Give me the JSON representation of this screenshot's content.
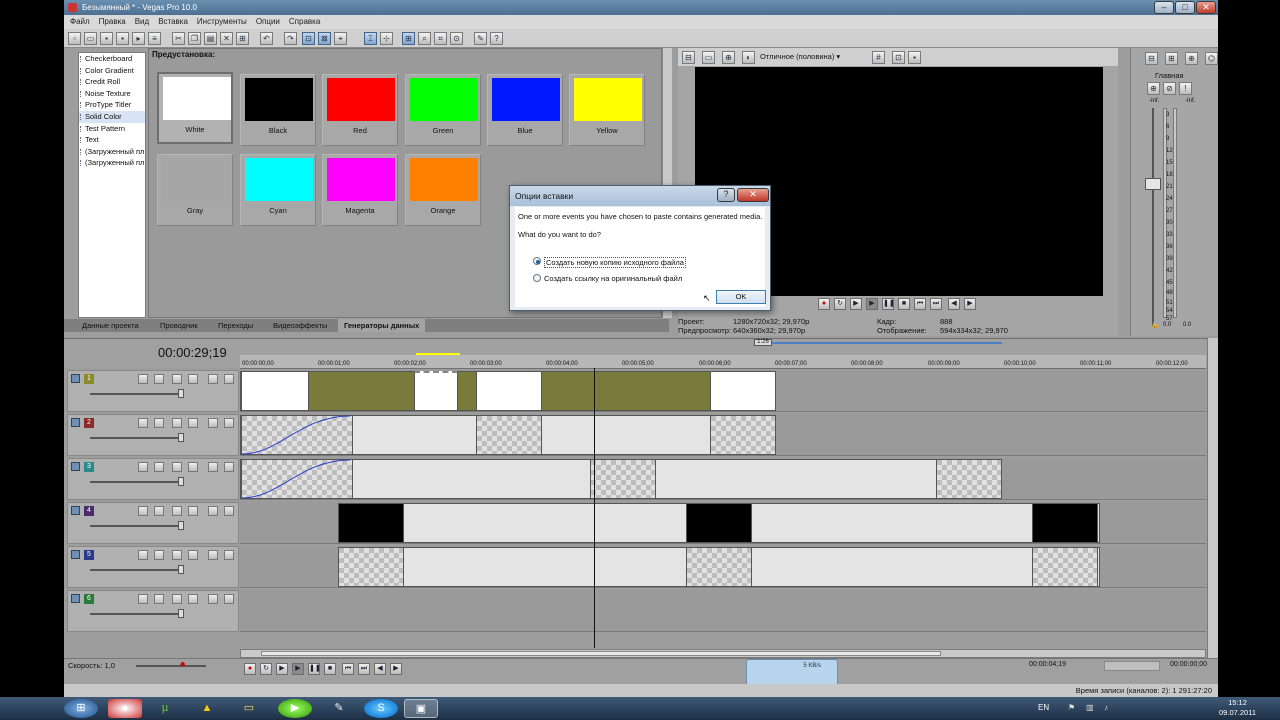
{
  "window": {
    "title": "Безымянный * - Vegas Pro 10.0",
    "minimize": "–",
    "maximize": "□",
    "close": "✕"
  },
  "menu": [
    "Файл",
    "Правка",
    "Вид",
    "Вставка",
    "Инструменты",
    "Опции",
    "Справка"
  ],
  "generators": {
    "items": [
      "Checkerboard",
      "Color Gradient",
      "Credit Roll",
      "Noise Texture",
      "ProType Titler",
      "Solid Color",
      "Test Pattern",
      "Text",
      "(Загруженный пл",
      "(Загруженный пл"
    ],
    "selected_index": 5,
    "preset_title": "Предустановка:",
    "presets": [
      {
        "label": "White",
        "color": "#ffffff"
      },
      {
        "label": "Black",
        "color": "#000000"
      },
      {
        "label": "Red",
        "color": "#ff0000"
      },
      {
        "label": "Green",
        "color": "#00ff00"
      },
      {
        "label": "Blue",
        "color": "#0018ff"
      },
      {
        "label": "Yellow",
        "color": "#ffff00"
      },
      {
        "label": "Gray",
        "color": "#a6a6a6"
      },
      {
        "label": "Cyan",
        "color": "#00ffff"
      },
      {
        "label": "Magenta",
        "color": "#ff00ff"
      },
      {
        "label": "Orange",
        "color": "#ff7f00"
      }
    ]
  },
  "tabs": [
    "Данные проекта",
    "Проводник",
    "Переходы",
    "Видеоэффекты",
    "Генераторы данных"
  ],
  "active_tab": 4,
  "preview": {
    "quality": "Отличное (половина)",
    "project_label": "Проект:",
    "project_value": "1280x720x32; 29,970p",
    "preview_label": "Предпросмотр:",
    "preview_value": "640x360x32; 29,970p",
    "frame_label": "Кадр:",
    "frame_value": "888",
    "display_label": "Отображение:",
    "display_value": "594x334x32; 29,970"
  },
  "mixer": {
    "title": "Главная",
    "left_db": "-Inf.",
    "right_db": "-Inf.",
    "scale": [
      "3",
      "6",
      "9",
      "12",
      "15",
      "18",
      "21",
      "24",
      "27",
      "30",
      "33",
      "36",
      "39",
      "42",
      "45",
      "48",
      "51",
      "54",
      "57"
    ],
    "out_left": "0.0",
    "out_right": "0.0"
  },
  "timeline": {
    "timecode": "00:00:29;19",
    "ruler": [
      "00:00:00;00",
      "00:00:01;00",
      "00:00:02;00",
      "00:00:03;00",
      "00:00:04;00",
      "00:00:05;00",
      "00:00:06;00",
      "00:00:07;00",
      "00:00:08;00",
      "00:00:09;00",
      "00:00:10;00",
      "00:00:11;00",
      "00:00:12;00"
    ],
    "tracks": [
      {
        "num": "1",
        "color": "#8a8a2a"
      },
      {
        "num": "2",
        "color": "#8a2a2a"
      },
      {
        "num": "3",
        "color": "#2a8a8a"
      },
      {
        "num": "4",
        "color": "#4a2a6a"
      },
      {
        "num": "5",
        "color": "#2a3a8a"
      },
      {
        "num": "6",
        "color": "#2a7a3a"
      }
    ],
    "region_label": "1:26",
    "speed": "Скорость: 1,0"
  },
  "transport": {
    "cursor_time": "00:00:04;19",
    "end_time": "00:00:00;00"
  },
  "status": {
    "record_time": "Время записи (каналов: 2): 1 291:27:20"
  },
  "meter_popup": {
    "rate": "5 KB/s"
  },
  "dialog": {
    "title": "Опции вставки",
    "message": "One or more events you have chosen to paste contains generated media.",
    "question": "What do you want to do?",
    "option1": "Создать новую копию исходного файла",
    "option2": "Создать ссылку на оригинальный файл",
    "ok": "OK",
    "close": "✕",
    "help": "?"
  },
  "taskbar": {
    "lang": "EN",
    "time": "15:12",
    "date": "09.07.2011"
  }
}
